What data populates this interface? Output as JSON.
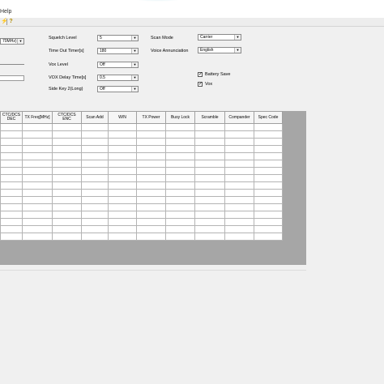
{
  "menu": {
    "help": "Help"
  },
  "toolbar": {
    "icons": [
      "lightning-icon",
      "help-icon"
    ]
  },
  "settings": {
    "left_combo_value": "70MHz)",
    "squelch_level": {
      "label": "Squelch Level",
      "value": "5"
    },
    "time_out_timer": {
      "label": "Time Out Timer[s]",
      "value": "180"
    },
    "vox_level": {
      "label": "Vox Level",
      "value": "Off"
    },
    "vox_delay_time": {
      "label": "VOX Delay Time[s]",
      "value": "0.5"
    },
    "side_key_2_long": {
      "label": "Side Key 2(Long)",
      "value": "Off"
    },
    "scan_mode": {
      "label": "Scan Mode",
      "value": "Carrier"
    },
    "voice_annunciation": {
      "label": "Voice Annunciation",
      "value": "English"
    },
    "battery_save": {
      "label": "Battery Save",
      "checked": true
    },
    "vox": {
      "label": "Vox",
      "checked": true
    }
  },
  "grid": {
    "columns": [
      "CTC/DCS DEC",
      "TX Freq[MHz]",
      "CTC/DCS ENC",
      "Scan Add",
      "W/N",
      "TX Power",
      "Busy Lock",
      "Scramble",
      "Compander",
      "Spec Code"
    ],
    "row_count": 16
  }
}
